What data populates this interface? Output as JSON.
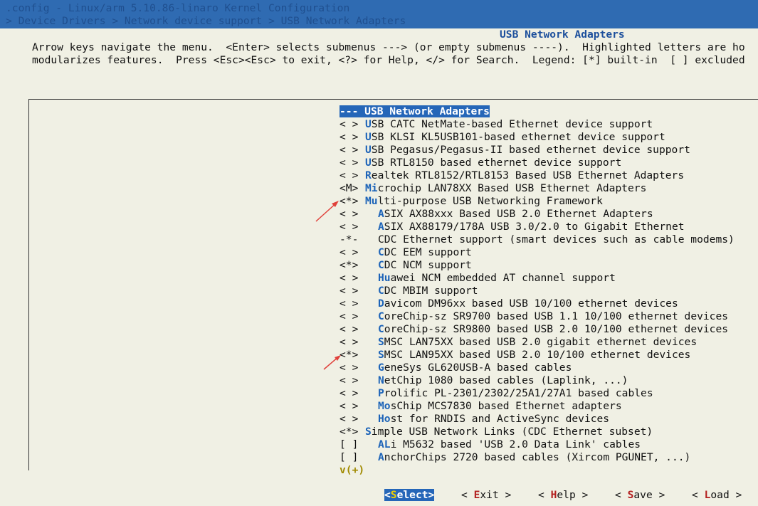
{
  "topbar": {
    "line1": ".config - Linux/arm 5.10.86-linaro Kernel Configuration",
    "line2": "> Device Drivers > Network device support > USB Network Adapters"
  },
  "dialog": {
    "title": "USB Network Adapters",
    "help_line1": "Arrow keys navigate the menu.  <Enter> selects submenus ---> (or empty submenus ----).  Highlighted letters are ho",
    "help_line2": "modularizes features.  Press <Esc><Esc> to exit, <?> for Help, </> for Search.  Legend: [*] built-in  [ ] excluded"
  },
  "menu": {
    "items": [
      {
        "mark": "---",
        "hot": "",
        "rest": "USB Network Adapters",
        "selected": true
      },
      {
        "mark": "< >",
        "hot": "U",
        "rest": "SB CATC NetMate-based Ethernet device support"
      },
      {
        "mark": "< >",
        "hot": "U",
        "rest": "SB KLSI KL5USB101-based ethernet device support"
      },
      {
        "mark": "< >",
        "hot": "U",
        "rest": "SB Pegasus/Pegasus-II based ethernet device support"
      },
      {
        "mark": "< >",
        "hot": "U",
        "rest": "SB RTL8150 based ethernet device support"
      },
      {
        "mark": "< >",
        "hot": "R",
        "rest": "ealtek RTL8152/RTL8153 Based USB Ethernet Adapters"
      },
      {
        "mark": "<M>",
        "hot": "Mi",
        "rest": "crochip LAN78XX Based USB Ethernet Adapters"
      },
      {
        "mark": "<*>",
        "hot": "Mu",
        "rest": "lti-purpose USB Networking Framework"
      },
      {
        "mark": "< >",
        "indent": true,
        "hot": "A",
        "rest": "SIX AX88xxx Based USB 2.0 Ethernet Adapters"
      },
      {
        "mark": "< >",
        "indent": true,
        "hot": "A",
        "rest": "SIX AX88179/178A USB 3.0/2.0 to Gigabit Ethernet"
      },
      {
        "mark": "-*-",
        "indent": true,
        "hot": "",
        "rest": "CDC Ethernet support (smart devices such as cable modems)"
      },
      {
        "mark": "< >",
        "indent": true,
        "hot": "C",
        "rest": "DC EEM support"
      },
      {
        "mark": "<*>",
        "indent": true,
        "hot": "C",
        "rest": "DC NCM support"
      },
      {
        "mark": "< >",
        "indent": true,
        "hot": "Hu",
        "rest": "awei NCM embedded AT channel support"
      },
      {
        "mark": "< >",
        "indent": true,
        "hot": "C",
        "rest": "DC MBIM support"
      },
      {
        "mark": "< >",
        "indent": true,
        "hot": "D",
        "rest": "avicom DM96xx based USB 10/100 ethernet devices"
      },
      {
        "mark": "< >",
        "indent": true,
        "hot": "C",
        "rest": "oreChip-sz SR9700 based USB 1.1 10/100 ethernet devices"
      },
      {
        "mark": "< >",
        "indent": true,
        "hot": "C",
        "rest": "oreChip-sz SR9800 based USB 2.0 10/100 ethernet devices"
      },
      {
        "mark": "< >",
        "indent": true,
        "hot": "S",
        "rest": "MSC LAN75XX based USB 2.0 gigabit ethernet devices"
      },
      {
        "mark": "<*>",
        "indent": true,
        "hot": "S",
        "rest": "MSC LAN95XX based USB 2.0 10/100 ethernet devices"
      },
      {
        "mark": "< >",
        "indent": true,
        "hot": "G",
        "rest": "eneSys GL620USB-A based cables"
      },
      {
        "mark": "< >",
        "indent": true,
        "hot": "N",
        "rest": "etChip 1080 based cables (Laplink, ...)"
      },
      {
        "mark": "< >",
        "indent": true,
        "hot": "P",
        "rest": "rolific PL-2301/2302/25A1/27A1 based cables"
      },
      {
        "mark": "< >",
        "indent": true,
        "hot": "Mo",
        "rest": "sChip MCS7830 based Ethernet adapters"
      },
      {
        "mark": "< >",
        "indent": true,
        "hot": "Ho",
        "rest": "st for RNDIS and ActiveSync devices"
      },
      {
        "mark": "<*>",
        "hot": "S",
        "rest": "imple USB Network Links (CDC Ethernet subset)"
      },
      {
        "mark": "[ ]",
        "indent": true,
        "hot": "AL",
        "rest": "i M5632 based 'USB 2.0 Data Link' cables"
      },
      {
        "mark": "[ ]",
        "indent": true,
        "hot": "A",
        "rest": "nchorChips 2720 based cables (Xircom PGUNET, ...)"
      }
    ],
    "more_indicator": "v(+)"
  },
  "buttons": [
    {
      "open": "<",
      "hot": "S",
      "rest": "elect",
      "close": ">",
      "selected": true
    },
    {
      "open": "< ",
      "hot": "E",
      "rest": "xit",
      "close": " >"
    },
    {
      "open": "< ",
      "hot": "H",
      "rest": "elp",
      "close": " >"
    },
    {
      "open": "< ",
      "hot": "S",
      "rest": "ave",
      "close": " >"
    },
    {
      "open": "< ",
      "hot": "L",
      "rest": "oad",
      "close": " >"
    }
  ],
  "colors": {
    "background": "#f0f0e4",
    "topbar": "#2f6bb2",
    "selection": "#2566b8",
    "hotkey": "#1c63b8",
    "annotation_arrow": "#e0403a"
  }
}
